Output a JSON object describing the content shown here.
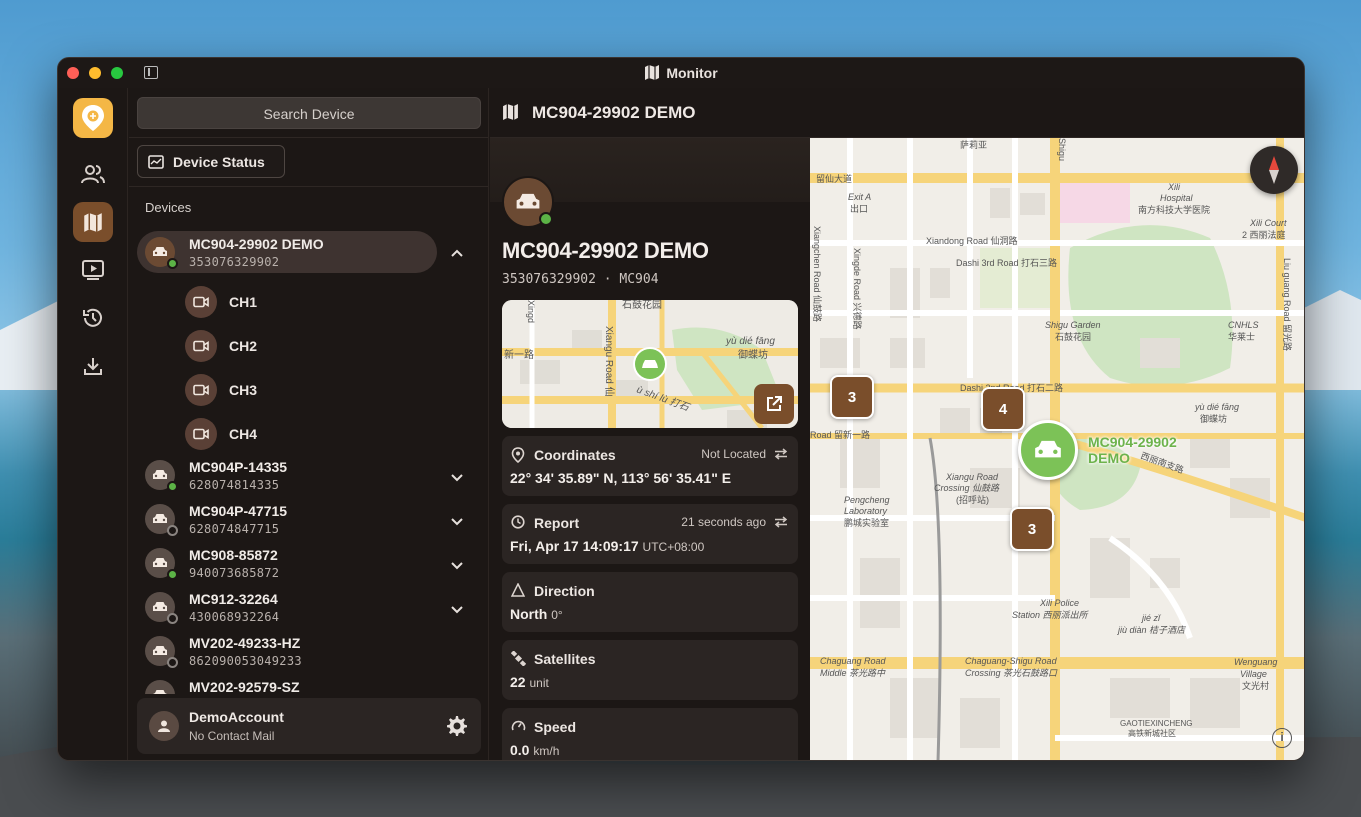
{
  "window": {
    "title": "Monitor"
  },
  "header": {
    "title": "MC904-29902 DEMO"
  },
  "panel": {
    "search_label": "Search Device",
    "device_status_label": "Device Status",
    "devices_heading": "Devices"
  },
  "devices": [
    {
      "name": "MC904-29902 DEMO",
      "imei": "353076329902",
      "online": true,
      "expanded": true
    },
    {
      "name": "MC904P-14335",
      "imei": "628074814335",
      "online": true,
      "expanded": false
    },
    {
      "name": "MC904P-47715",
      "imei": "628074847715",
      "online": false,
      "expanded": false
    },
    {
      "name": "MC908-85872",
      "imei": "940073685872",
      "online": true,
      "expanded": false
    },
    {
      "name": "MC912-32264",
      "imei": "430068932264",
      "online": false,
      "expanded": false
    },
    {
      "name": "MV202-49233-HZ",
      "imei": "862090053049233",
      "online": false,
      "expanded": false
    },
    {
      "name": "MV202-92579-SZ",
      "imei": "",
      "online": false,
      "expanded": false
    }
  ],
  "channels": [
    "CH1",
    "CH2",
    "CH3",
    "CH4"
  ],
  "account": {
    "name": "DemoAccount",
    "mail": "No Contact Mail"
  },
  "detail": {
    "name": "MC904-29902 DEMO",
    "subtitle": "353076329902 · MC904",
    "coordinates": {
      "title": "Coordinates",
      "status": "Not Located",
      "value": "22° 34' 35.89\" N, 113° 56' 35.41\" E"
    },
    "report": {
      "title": "Report",
      "ago": "21 seconds ago",
      "value": "Fri, Apr 17 14:09:17",
      "tz": "UTC+08:00"
    },
    "direction": {
      "title": "Direction",
      "value": "North",
      "unit": "0°"
    },
    "satellites": {
      "title": "Satellites",
      "value": "22",
      "unit": "unit"
    },
    "speed": {
      "title": "Speed",
      "value": "0.0",
      "unit": "km/h"
    }
  },
  "minimap": {
    "labels": [
      "石鼓花园",
      "yù dié fāng",
      "御蝶坊",
      "新一路",
      "Xiangu Road 仙",
      "ù shí lù 打石",
      "Xingd"
    ]
  },
  "map": {
    "clusters": [
      "3",
      "4",
      "3"
    ],
    "pin_label_line1": "MC904-29902",
    "pin_label_line2": "DEMO",
    "info": "i",
    "labels": {
      "saping": "萨莉亚",
      "liuxian": "留仙大道",
      "exit_a": "Exit A",
      "exit_a_cn": "出口",
      "xili_hospital": "Xili",
      "xili_hospital2": "Hospital",
      "xili_hospital_cn": "南方科技大学医院",
      "xiali_court": "Xili Court",
      "xiali_court_cn": "2 西丽法庭",
      "xiandong": "Xiandong Road 仙洞路",
      "dashi3": "Dashi 3rd Road 打石三路",
      "shigu_garden": "Shigu Garden",
      "shigu_garden_cn": "石鼓花园",
      "cnhls": "CNHLS",
      "cnhls_cn": "华莱士",
      "dashi2": "Dashi 2nd Road 打石二路",
      "yudie": "yù dié fāng",
      "yudie_cn": "御蝶坊",
      "liuxin1": "Road 留新一路",
      "xiangu_crossing": "Xiangu Road",
      "xiangu_crossing2": "Crossing 仙鼓路",
      "xiangu_crossing3": "(招呼站)",
      "xili_nan": "西丽南支路",
      "pengcheng": "Pengcheng",
      "pengcheng2": "Laboratory",
      "pengcheng_cn": "鹏城实验室",
      "xili_police": "Xili Police",
      "xili_police2": "Station 西丽派出所",
      "jiezi": "jié zǐ",
      "jiezi_cn": "jiù diàn 桔子酒店",
      "chaguang_mid": "Chaguang Road",
      "chaguang_mid2": "Middle 茶光路中",
      "chaguang_cross": "Chaguang-Shigu Road",
      "chaguang_cross2": "Crossing 茶光石鼓路口",
      "wenguang": "Wenguang",
      "wenguang2": "Village",
      "wenguang_cn": "文光村",
      "gaotie": "GAOTIEXINCHENG",
      "gaotie_cn": "高铁新城社区",
      "xingde": "Xingde Road 兴德路",
      "xiangchen": "Xiangchen Road 仙鼓路",
      "shigu_rd": "Shigu",
      "liuguang": "Liu guang Road 留光路"
    }
  },
  "colors": {
    "accent": "#7a4e2b",
    "logo": "#f4b746",
    "online": "#5cb346",
    "pin": "#7cc257"
  }
}
